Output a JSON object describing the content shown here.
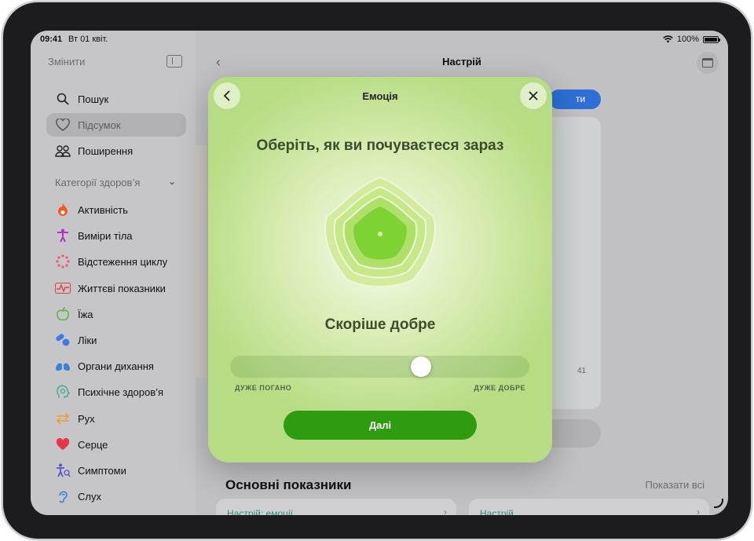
{
  "status_bar": {
    "time": "09:41",
    "date": "Вт 01 квіт.",
    "battery": "100%"
  },
  "sidebar": {
    "edit_label": "Змінити",
    "top_items": [
      {
        "label": "Пошук",
        "icon": "search-icon"
      },
      {
        "label": "Підсумок",
        "icon": "heart-outline-icon",
        "selected": true
      },
      {
        "label": "Поширення",
        "icon": "people-icon"
      }
    ],
    "section_title": "Категорії здоров’я",
    "categories": [
      {
        "label": "Активність",
        "icon": "flame-icon",
        "color": "#f2582a"
      },
      {
        "label": "Виміри тіла",
        "icon": "figure-icon",
        "color": "#b032c8"
      },
      {
        "label": "Відстеження циклу",
        "icon": "cycle-icon",
        "color": "#f0546e"
      },
      {
        "label": "Життєві показники",
        "icon": "vitals-icon",
        "color": "#d9444a"
      },
      {
        "label": "Їжа",
        "icon": "apple-icon",
        "color": "#57b443"
      },
      {
        "label": "Ліки",
        "icon": "pills-icon",
        "color": "#3d7be3"
      },
      {
        "label": "Органи дихання",
        "icon": "lungs-icon",
        "color": "#3a82d6"
      },
      {
        "label": "Психічне здоров’я",
        "icon": "head-icon",
        "color": "#3fae97"
      },
      {
        "label": "Рух",
        "icon": "arrows-icon",
        "color": "#f29a2e"
      },
      {
        "label": "Серце",
        "icon": "heart-icon",
        "color": "#e8344a"
      },
      {
        "label": "Симптоми",
        "icon": "symptoms-icon",
        "color": "#5b52c7"
      },
      {
        "label": "Слух",
        "icon": "ear-icon",
        "color": "#3a80d9"
      }
    ]
  },
  "main": {
    "title": "Настрій",
    "pill_text": "ти",
    "bg_time": "41",
    "section_title": "Основні показники",
    "show_all": "Показати всі",
    "cards": [
      {
        "label": "Настрій: емоції"
      },
      {
        "label": "Настрій"
      }
    ]
  },
  "modal": {
    "title": "Емоція",
    "question": "Оберіть, як ви почуваєтеся зараз",
    "mood_label": "Скоріше добре",
    "slider": {
      "value": 0.65,
      "min_label": "ДУЖЕ ПОГАНО",
      "max_label": "ДУЖЕ ДОБРЕ"
    },
    "next_label": "Далі"
  },
  "colors": {
    "accent_green": "#2e9b10",
    "pill_blue": "#2d6fd4"
  }
}
